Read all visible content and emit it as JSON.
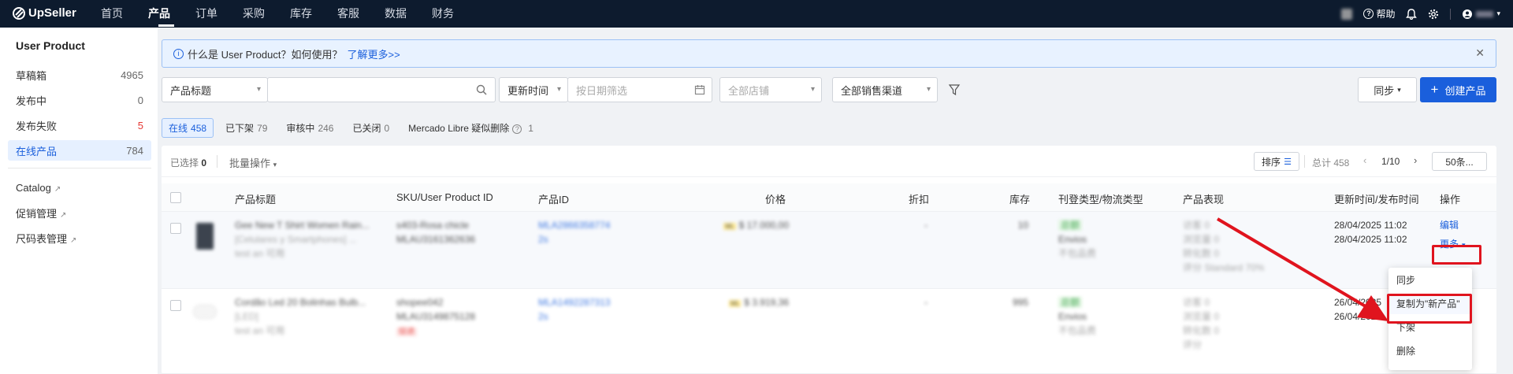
{
  "topbar": {
    "logo": "UpSeller",
    "nav": [
      "首页",
      "产品",
      "订单",
      "采购",
      "库存",
      "客服",
      "数据",
      "财务"
    ],
    "help": "帮助"
  },
  "sidebar": {
    "title": "User Product",
    "items": [
      {
        "label": "草稿箱",
        "count": "4965"
      },
      {
        "label": "发布中",
        "count": "0"
      },
      {
        "label": "发布失败",
        "count": "5"
      },
      {
        "label": "在线产品",
        "count": "784"
      }
    ],
    "links": [
      "Catalog",
      "促销管理",
      "尺码表管理"
    ]
  },
  "banner": {
    "text": "什么是 User Product？如何使用？",
    "link": "了解更多>>"
  },
  "filters": {
    "title_select": "产品标题",
    "time_select": "更新时间",
    "date_placeholder": "按日期筛选",
    "store_placeholder": "全部店铺",
    "channel_select": "全部销售渠道",
    "sync_button": "同步",
    "create_button": "创建产品"
  },
  "tabs": [
    {
      "label": "在线",
      "count": "458"
    },
    {
      "label": "已下架",
      "count": "79"
    },
    {
      "label": "审核中",
      "count": "246"
    },
    {
      "label": "已关闭",
      "count": "0"
    },
    {
      "label": "Mercado Libre 疑似删除",
      "count": "1"
    }
  ],
  "toolbar": {
    "selected_label": "已选择",
    "selected_count": "0",
    "batch": "批量操作",
    "sort": "排序",
    "total": "总计 458",
    "page": "1/10",
    "page_size": "50条..."
  },
  "table": {
    "headers": [
      "产品标题",
      "SKU/User Product ID",
      "产品ID",
      "价格",
      "折扣",
      "库存",
      "刊登类型/物流类型",
      "产品表现",
      "更新时间/发布时间",
      "操作"
    ],
    "rows": [
      {
        "title": "Gee New T Shirt Women Rain...",
        "title2": "[Celulares y Smartphones] ...",
        "title3": "test an 可用",
        "sku": "s403-Rosa chicle",
        "upid": "MLAU3161362636",
        "pid": "MLA2866358774",
        "pid2": "2s",
        "price": "$ 17.000,00",
        "discount": "-",
        "stock": "10",
        "listing": "总额",
        "ship": "Envios",
        "ship2": "不包品费",
        "perf": [
          "访客 0",
          "浏览量 0",
          "转化数 0",
          "评分 Standard 70%"
        ],
        "updated": "28/04/2025 11:02",
        "published": "28/04/2025 11:02",
        "edit": "编辑",
        "more": "更多"
      },
      {
        "title": "Cordão Led 20 Bolinhas Bulb...",
        "title2": "[LED]",
        "title3": "test an 可用",
        "sku": "shopee042",
        "upid": "MLAU3149875128",
        "badge": "促进",
        "pid": "MLA1492287313",
        "pid2": "2s",
        "price": "$ 3.919,36",
        "discount": "-",
        "stock": "995",
        "listing": "总额",
        "ship": "Envios",
        "ship2": "不包品费",
        "perf": [
          "访客 0",
          "浏览量 0",
          "转化数 0",
          "评分"
        ],
        "updated": "26/04/2025",
        "published": "26/04/2025"
      }
    ]
  },
  "dropdown": {
    "items": [
      "同步",
      "复制为\"新产品\"",
      "下架",
      "删除"
    ]
  },
  "colors": {
    "topbar": "#0d1b2e",
    "accent": "#1a5fdc",
    "highlight": "#e0141e"
  }
}
